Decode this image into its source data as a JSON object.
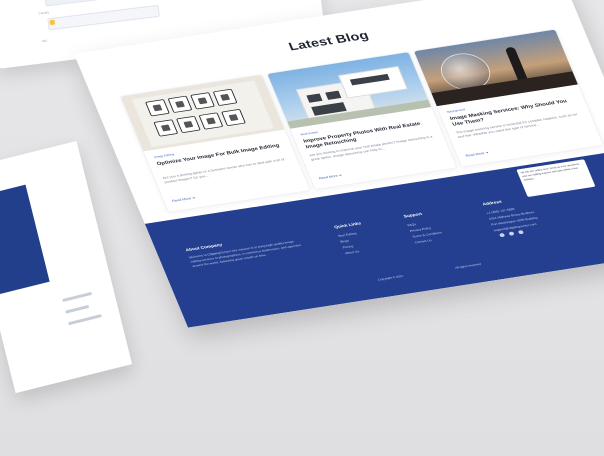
{
  "section_title": "Latest Blog",
  "blog_cards": [
    {
      "category": "Image Editing",
      "title": "Optimize Your Image For Bulk Image Editing",
      "excerpt": "Are you a photographer or a business owner who has to deal with a lot of product images? Do you...",
      "read_more": "Read More"
    },
    {
      "category": "Real Estate",
      "title": "Improve Property Photos With Real Estate Image Retouching",
      "excerpt": "Are you looking to improve your real estate photos? Image retouching is a great option. Image retouching can help to...",
      "read_more": "Read More"
    },
    {
      "category": "Background",
      "title": "Image Masking Services: Why Should You Use Them?",
      "excerpt": "The image masking service is essential for complex subjects, such as fur and hair. Whether you need this type of service...",
      "read_more": "Read More"
    }
  ],
  "footer": {
    "about": {
      "heading": "About Company",
      "text": "Welcome to ClippingCenter! Our mission is to bring high-quality image editing services to photographers, e-commerce businesses, and agencies around the world, delivering great results on time."
    },
    "quick_links": {
      "heading": "Quick Links",
      "items": [
        "Start Editing",
        "Blogs",
        "Pricing",
        "About Us"
      ]
    },
    "support": {
      "heading": "Support",
      "items": [
        "FAQs",
        "Privacy Policy",
        "Terms & Conditions",
        "Contact Us"
      ]
    },
    "address": {
      "heading": "Address",
      "phone": "+1 (206) 727-5888",
      "lines": [
        "1014 Highway Bossy Brothers",
        "Fort Washington 4200 Building",
        "support@clippingcenter.com"
      ]
    },
    "copyright": "Copyright © 2022",
    "brand_note": "All rights reserved",
    "tooltip_text": "Hi! We are online now. Send us your questions and our editing experts will reply within a few minutes."
  },
  "icons": {
    "settings": "gear-icon"
  },
  "colors": {
    "footer_bg": "#243f8f",
    "accent": "#3c66c7"
  }
}
